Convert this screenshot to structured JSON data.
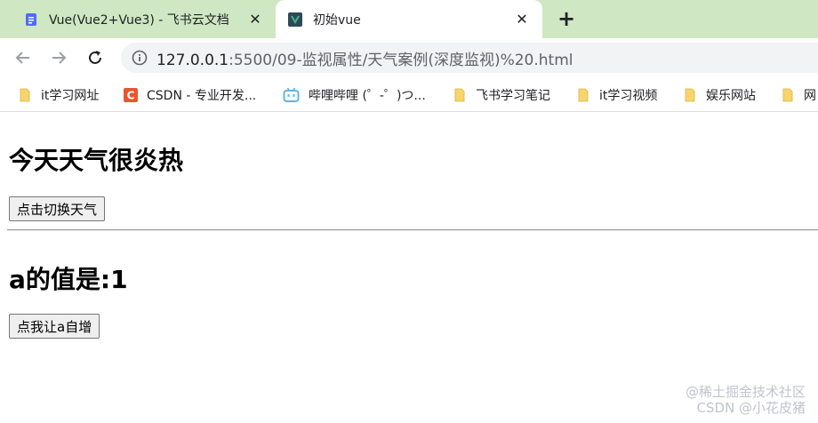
{
  "browser": {
    "tabs": [
      {
        "title": "Vue(Vue2+Vue3) - 飞书云文档",
        "active": false
      },
      {
        "title": "初始vue",
        "active": true
      }
    ],
    "url_host": "127.0.0.1",
    "url_rest": ":5500/09-监视属性/天气案例(深度监视)%20.html",
    "bookmarks": [
      {
        "label": "it学习网址",
        "icon": "folder-icon"
      },
      {
        "label": "CSDN - 专业开发...",
        "icon": "csdn-icon"
      },
      {
        "label": "哔哩哔哩 (゜-゜)つ...",
        "icon": "bilibili-icon"
      },
      {
        "label": "飞书学习笔记",
        "icon": "folder-icon"
      },
      {
        "label": "it学习视频",
        "icon": "folder-icon"
      },
      {
        "label": "娱乐网站",
        "icon": "folder-icon"
      },
      {
        "label": "网",
        "icon": "folder-icon"
      }
    ]
  },
  "page": {
    "weather_heading": "今天天气很炎热",
    "switch_button": "点击切换天气",
    "a_heading": "a的值是:1",
    "increment_button": "点我让a自增"
  },
  "watermark": {
    "line1": "@稀土掘金技术社区",
    "line2": "CSDN @小花皮猪"
  },
  "colors": {
    "tabstrip": "#cfe7c2",
    "omnibox": "#f1f3f4",
    "folder": "#f7d56b",
    "csdn": "#e9552f",
    "bilibili": "#5bb6e8"
  }
}
